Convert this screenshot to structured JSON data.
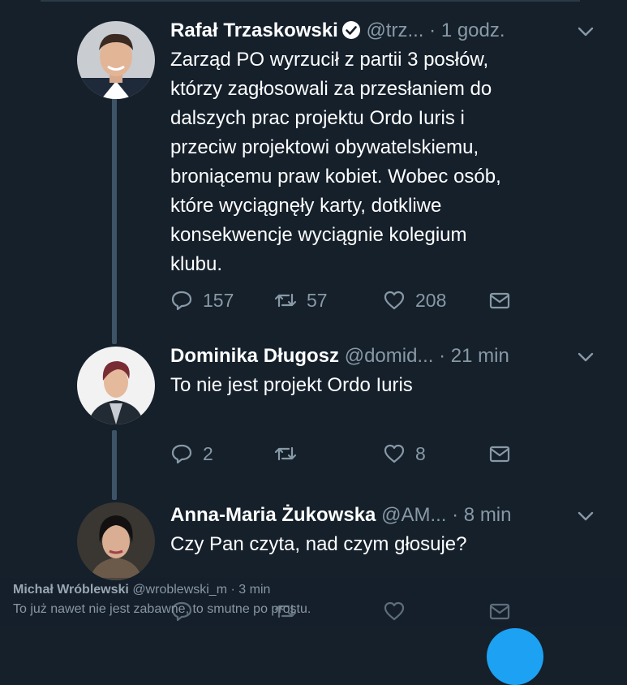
{
  "tweets": [
    {
      "name": "Rafał Trzaskowski",
      "handle": "@trz...",
      "dot": "·",
      "time": "1 godz.",
      "verified": true,
      "text": "Zarząd PO wyrzucił z partii 3 posłów,\nktórzy zagłosowali za przesłaniem do\ndalszych prac projektu Ordo Iuris i\nprzeciw projektowi obywatelskiemu,\nbroniącemu praw kobiet. Wobec osób,\nktóre wyciągnęły karty,  dotkliwe\nkonsekwencje wyciągnie kolegium\nklubu.",
      "replies": "157",
      "retweets": "57",
      "likes": "208"
    },
    {
      "name": "Dominika Długosz",
      "handle": "@domid...",
      "dot": "·",
      "time": "21 min",
      "verified": false,
      "text": "To nie jest projekt Ordo Iuris",
      "replies": "2",
      "retweets": "",
      "likes": "8"
    },
    {
      "name": "Anna-Maria Żukowska",
      "handle": "@AM...",
      "dot": "·",
      "time": "8 min",
      "verified": false,
      "text": "Czy Pan czyta, nad czym głosuje?",
      "replies": "",
      "retweets": "",
      "likes": ""
    }
  ],
  "overlay": {
    "name": "Michał Wróblewski",
    "handle": "@wroblewski_m",
    "dot": "·",
    "time": "3 min",
    "text": "To już nawet nie jest zabawne, to smutne po prostu."
  },
  "colors": {
    "background": "#15202b",
    "secondary_text": "#8899a6",
    "thread_line": "#3d5466",
    "accent": "#1da1f2"
  },
  "icons": [
    "verified-badge-icon",
    "chevron-down-icon",
    "reply-icon",
    "retweet-icon",
    "like-icon",
    "message-icon"
  ]
}
